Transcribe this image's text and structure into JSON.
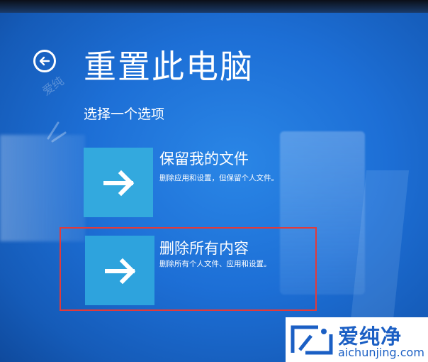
{
  "screen": {
    "title": "重置此电脑",
    "subtitle": "选择一个选项"
  },
  "icons": {
    "back": "back-arrow-circle-icon",
    "arrow": "arrow-right-icon",
    "brand_logo": "aichunjing-logo-icon"
  },
  "options": [
    {
      "title": "保留我的文件",
      "description": "删除应用和设置，但保留个人文件。"
    },
    {
      "title": "删除所有内容",
      "description": "删除所有个人文件、应用和设置。"
    }
  ],
  "watermark": {
    "side_text": "爱纯",
    "brand_name": "爱纯净",
    "brand_url": "aichunjing.com"
  },
  "colors": {
    "background": "#1f6fd0",
    "tile": "#2ea3dd",
    "highlight": "#e23a3a",
    "brand": "#1b5fc4"
  }
}
